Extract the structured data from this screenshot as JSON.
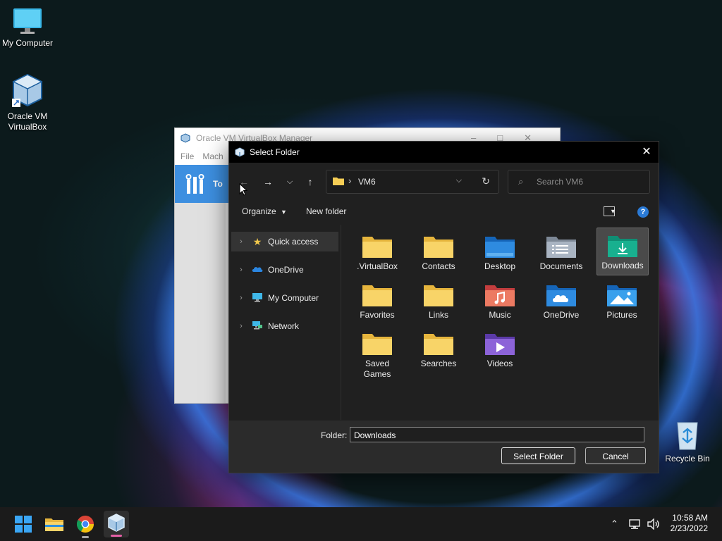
{
  "desktop": {
    "icons": [
      {
        "label": "My Computer"
      },
      {
        "label": "Oracle VM VirtualBox"
      },
      {
        "label": "Recycle Bin"
      }
    ]
  },
  "bg_window": {
    "title": "Oracle VM VirtualBox Manager",
    "menu": [
      "File",
      "Mach"
    ],
    "tools_label": "To"
  },
  "dialog": {
    "title": "Select Folder",
    "address": {
      "crumb": "VM6"
    },
    "search": {
      "placeholder": "Search VM6"
    },
    "toolbar": {
      "organize": "Organize",
      "new_folder": "New folder",
      "help": "?"
    },
    "nav": [
      {
        "label": "Quick access",
        "icon": "star-icon"
      },
      {
        "label": "OneDrive",
        "icon": "cloud-icon"
      },
      {
        "label": "My Computer",
        "icon": "monitor-icon"
      },
      {
        "label": "Network",
        "icon": "network-icon"
      }
    ],
    "folders": [
      {
        "label": ".VirtualBox",
        "icon": "folder-icon"
      },
      {
        "label": "Contacts",
        "icon": "folder-icon"
      },
      {
        "label": "Desktop",
        "icon": "desktop-folder-icon"
      },
      {
        "label": "Documents",
        "icon": "documents-folder-icon"
      },
      {
        "label": "Downloads",
        "icon": "downloads-folder-icon"
      },
      {
        "label": "Favorites",
        "icon": "folder-icon"
      },
      {
        "label": "Links",
        "icon": "folder-icon"
      },
      {
        "label": "Music",
        "icon": "music-folder-icon"
      },
      {
        "label": "OneDrive",
        "icon": "onedrive-folder-icon"
      },
      {
        "label": "Pictures",
        "icon": "pictures-folder-icon"
      },
      {
        "label": "Saved Games",
        "icon": "folder-icon"
      },
      {
        "label": "Searches",
        "icon": "folder-icon"
      },
      {
        "label": "Videos",
        "icon": "videos-folder-icon"
      }
    ],
    "selected_folder": "Downloads",
    "footer": {
      "folder_label": "Folder:",
      "folder_value": "Downloads",
      "select_button": "Select Folder",
      "cancel_button": "Cancel"
    }
  },
  "taskbar": {
    "time": "10:58 AM",
    "date": "2/23/2022"
  },
  "colors": {
    "accent": "#2a7ad6",
    "folder_yellow": "#f6cd55",
    "dialog_bg": "#202020"
  }
}
